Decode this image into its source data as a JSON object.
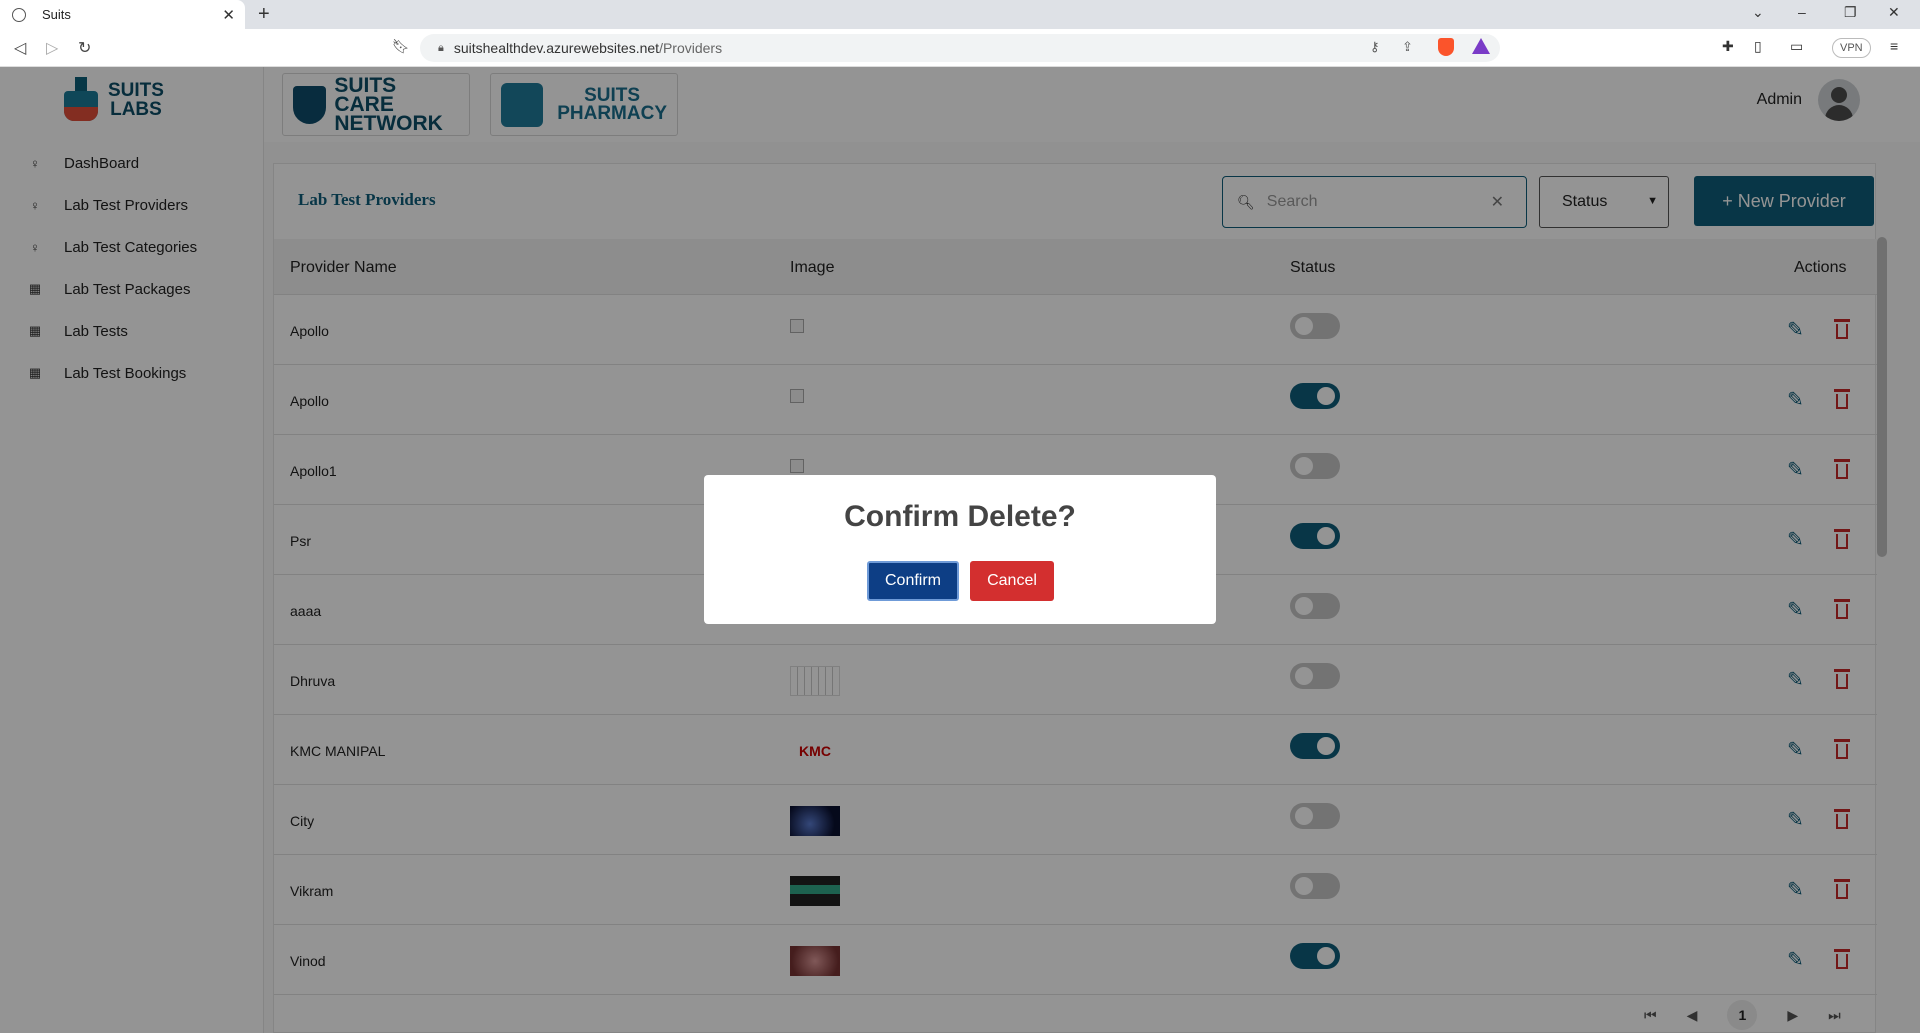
{
  "browser": {
    "tab_title": "Suits",
    "url_host": "suitshealthdev.azurewebsites.net",
    "url_path": "/Providers",
    "vpn_label": "VPN"
  },
  "sidebar": {
    "logo_line1": "SUITS",
    "logo_line2": "LABS",
    "items": [
      {
        "label": "DashBoard",
        "icon": "person-icon"
      },
      {
        "label": "Lab Test Providers",
        "icon": "person-icon"
      },
      {
        "label": "Lab Test Categories",
        "icon": "person-icon"
      },
      {
        "label": "Lab Test Packages",
        "icon": "calendar-icon"
      },
      {
        "label": "Lab Tests",
        "icon": "calendar-icon"
      },
      {
        "label": "Lab Test Bookings",
        "icon": "calendar-icon"
      }
    ]
  },
  "header": {
    "care_line1": "SUITS CARE",
    "care_line2": "NETWORK",
    "pharmacy_line1": "SUITS",
    "pharmacy_line2": "PHARMACY",
    "user_name": "Admin"
  },
  "main": {
    "title": "Lab Test Providers",
    "search_placeholder": "Search",
    "status_select": "Status",
    "new_button": "+ New Provider",
    "columns": [
      "Provider Name",
      "Image",
      "Status",
      "Actions"
    ],
    "rows": [
      {
        "name": "Apollo",
        "image": "broken",
        "active": false
      },
      {
        "name": "Apollo",
        "image": "broken",
        "active": true
      },
      {
        "name": "Apollo1",
        "image": "broken",
        "active": false
      },
      {
        "name": "Psr",
        "image": "none",
        "active": true
      },
      {
        "name": "aaaa",
        "image": "none",
        "active": false
      },
      {
        "name": "Dhruva",
        "image": "sketch",
        "active": false
      },
      {
        "name": "KMC MANIPAL",
        "image": "kmc-logo",
        "active": true
      },
      {
        "name": "City",
        "image": "space",
        "active": false
      },
      {
        "name": "Vikram",
        "image": "screen",
        "active": false
      },
      {
        "name": "Vinod",
        "image": "photo",
        "active": true
      }
    ],
    "pagination": {
      "current_page": "1"
    }
  },
  "modal": {
    "title": "Confirm Delete?",
    "confirm_label": "Confirm",
    "cancel_label": "Cancel"
  },
  "colors": {
    "primary": "#0e5e7a",
    "danger": "#d32f2f",
    "confirm": "#0d3e85"
  }
}
